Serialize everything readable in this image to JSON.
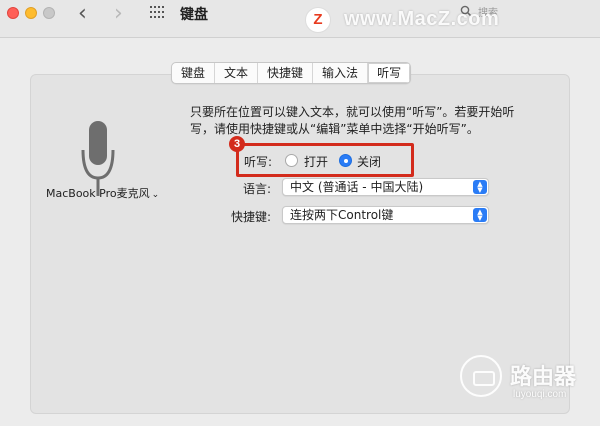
{
  "window": {
    "title": "键盘",
    "search_placeholder": "搜索"
  },
  "nav": {
    "back_glyph": "‹",
    "forward_glyph": "›"
  },
  "watermark": {
    "logo_letter": "Z",
    "site": "www.MacZ.com",
    "brand": "路由器",
    "brand_url": "luyouqi.com"
  },
  "tabs": [
    {
      "label": "键盘",
      "active": false
    },
    {
      "label": "文本",
      "active": false
    },
    {
      "label": "快捷键",
      "active": false
    },
    {
      "label": "输入法",
      "active": false
    },
    {
      "label": "听写",
      "active": true
    }
  ],
  "dictation": {
    "description_line1": "只要所在位置可以键入文本，就可以使用“听写”。若要开始听",
    "description_line2": "写，请使用快捷键或从“编辑”菜单中选择“开始听写”。",
    "mic_source": "MacBook Pro麦克风",
    "mic_chevron": "⌄",
    "dictation_label": "听写:",
    "option_on": "打开",
    "option_off": "关闭",
    "selected": "off",
    "language_label": "语言:",
    "language_value": "中文 (普通话 - 中国大陆)",
    "shortcut_label": "快捷键:",
    "shortcut_value": "连按两下Control键",
    "annotation_number": "3"
  },
  "colors": {
    "accent": "#2a7cf6",
    "highlight": "#d32b1c"
  },
  "icons": {
    "microphone": "microphone-icon",
    "search": "search-icon",
    "grid": "grid-icon"
  }
}
